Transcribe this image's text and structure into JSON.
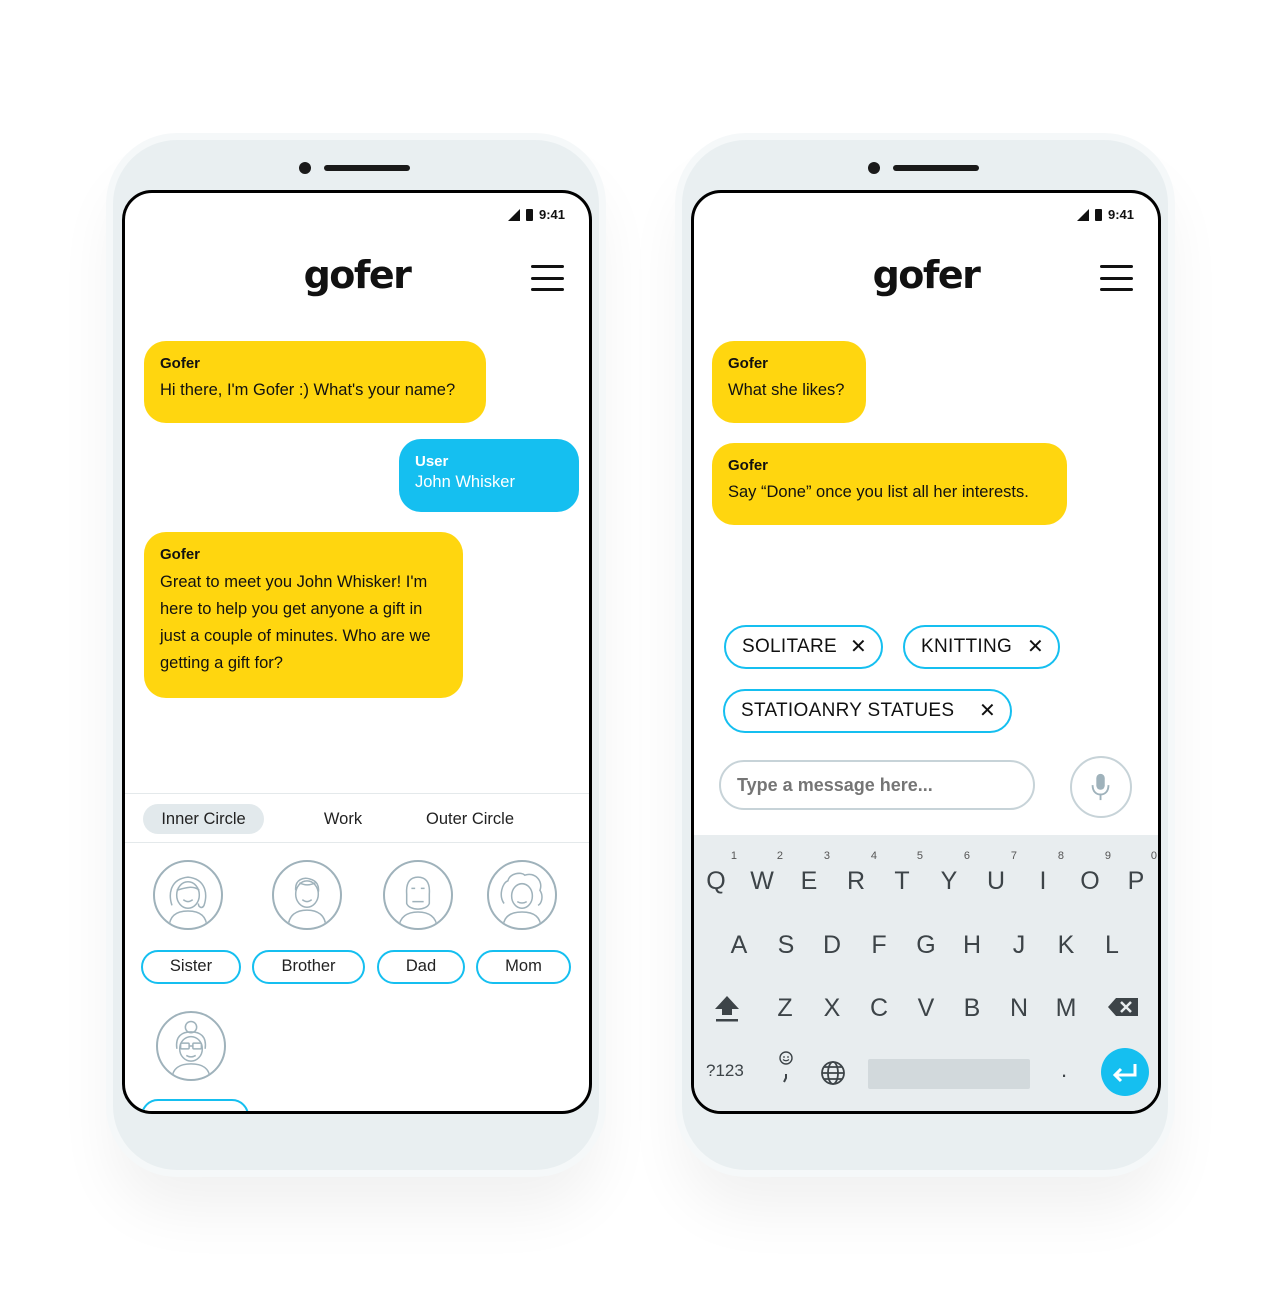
{
  "status_time": "9:41",
  "app_logo": "gofer",
  "left_phone": {
    "messages": [
      {
        "sender": "Gofer",
        "text": "Hi there, I'm Gofer :) What's your name?"
      },
      {
        "sender": "User",
        "text": "John Whisker"
      },
      {
        "sender": "Gofer",
        "text": "Great to meet you John Whisker! I'm here to help you get anyone a gift in just a couple of minutes. Who are we getting a gift for?"
      }
    ],
    "tabs": [
      "Inner Circle",
      "Work",
      "Outer Circle"
    ],
    "active_tab": "Inner Circle",
    "contacts": [
      "Sister",
      "Brother",
      "Dad",
      "Mom"
    ]
  },
  "right_phone": {
    "messages": [
      {
        "sender": "Gofer",
        "text": "What she likes?"
      },
      {
        "sender": "Gofer",
        "text": "Say “Done” once you list all her interests."
      }
    ],
    "chips": [
      "SOLITARE",
      "KNITTING",
      "STATIOANRY STATUES"
    ],
    "chip_remove_glyph": "✕",
    "input_placeholder": "Type a message here...",
    "keyboard": {
      "row1": [
        "Q",
        "W",
        "E",
        "R",
        "T",
        "Y",
        "U",
        "I",
        "O",
        "P"
      ],
      "row1_hints": [
        "1",
        "2",
        "3",
        "4",
        "5",
        "6",
        "7",
        "8",
        "9",
        "0"
      ],
      "row2": [
        "A",
        "S",
        "D",
        "F",
        "G",
        "H",
        "J",
        "K",
        "L"
      ],
      "row3": [
        "Z",
        "X",
        "C",
        "V",
        "B",
        "N",
        "M"
      ],
      "symbols_key": "?123",
      "period_key": "."
    }
  },
  "colors": {
    "gofer_bubble": "#ffd60f",
    "user_bubble": "#15bff0",
    "accent": "#15bff0"
  }
}
